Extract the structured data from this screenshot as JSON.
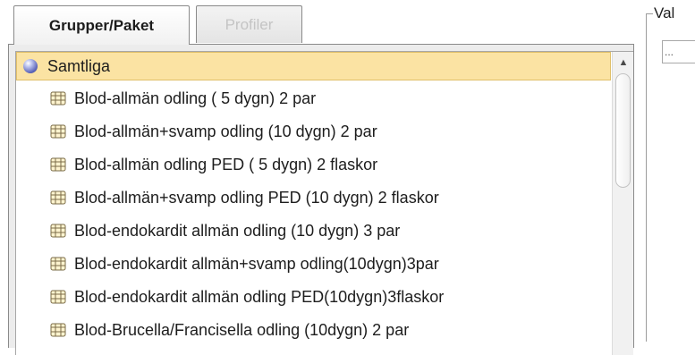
{
  "tabs": [
    {
      "label": "Grupper/Paket",
      "active": true
    },
    {
      "label": "Profiler",
      "active": false
    }
  ],
  "tree": {
    "root": {
      "label": "Samtliga",
      "icon": "sphere-icon",
      "selected": true
    },
    "items": [
      {
        "label": "Blod-allmän odling ( 5 dygn) 2 par",
        "icon": "grid-icon"
      },
      {
        "label": "Blod-allmän+svamp odling (10 dygn) 2 par",
        "icon": "grid-icon"
      },
      {
        "label": "Blod-allmän odling PED ( 5 dygn) 2 flaskor",
        "icon": "grid-icon"
      },
      {
        "label": "Blod-allmän+svamp odling PED (10 dygn) 2 flaskor",
        "icon": "grid-icon"
      },
      {
        "label": "Blod-endokardit allmän odling (10 dygn) 3 par",
        "icon": "grid-icon"
      },
      {
        "label": "Blod-endokardit allmän+svamp odling(10dygn)3par",
        "icon": "grid-icon"
      },
      {
        "label": "Blod-endokardit allmän odling PED(10dygn)3flaskor",
        "icon": "grid-icon"
      },
      {
        "label": "Blod-Brucella/Francisella odling (10dygn) 2 par",
        "icon": "grid-icon"
      }
    ]
  },
  "right_panel": {
    "group_title": "Val",
    "field_value": "..."
  },
  "colors": {
    "selection_background": "#fbe3a3",
    "selection_border": "#e0bf69",
    "panel_background": "#ececec",
    "inactive_tab_text": "#c4c4c4"
  }
}
